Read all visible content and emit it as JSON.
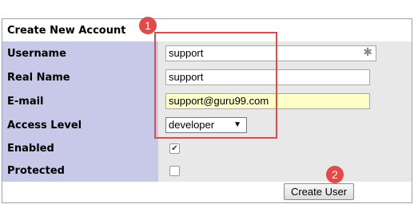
{
  "form": {
    "title": "Create New Account",
    "fields": {
      "username": {
        "label": "Username",
        "value": "support"
      },
      "realname": {
        "label": "Real Name",
        "value": "support"
      },
      "email": {
        "label": "E-mail",
        "value": "support@guru99.com"
      },
      "access": {
        "label": "Access Level",
        "value": "developer"
      },
      "enabled": {
        "label": "Enabled",
        "checked": true
      },
      "protected": {
        "label": "Protected",
        "checked": false
      }
    },
    "required_marker": "✱",
    "create_button_label": "Create User"
  },
  "annotations": {
    "step1": "1",
    "step2": "2",
    "accent_color": "#e24a4a"
  }
}
